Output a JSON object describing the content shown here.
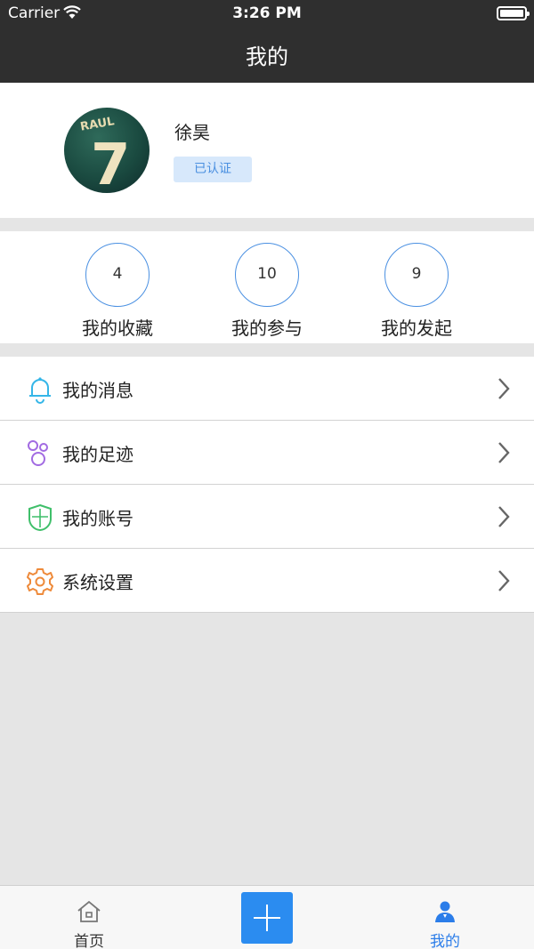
{
  "status_bar": {
    "carrier": "Carrier",
    "time": "3:26 PM"
  },
  "nav": {
    "title": "我的"
  },
  "profile": {
    "name": "徐昊",
    "badge": "已认证",
    "avatar_text": "RAUL",
    "avatar_number": "7"
  },
  "stats": [
    {
      "count": "4",
      "label": "我的收藏"
    },
    {
      "count": "10",
      "label": "我的参与"
    },
    {
      "count": "9",
      "label": "我的发起"
    }
  ],
  "menu": [
    {
      "label": "我的消息",
      "icon": "bell-icon",
      "color": "#35b6e8"
    },
    {
      "label": "我的足迹",
      "icon": "footprint-icon",
      "color": "#a26be2"
    },
    {
      "label": "我的账号",
      "icon": "shield-icon",
      "color": "#3fbf6a"
    },
    {
      "label": "系统设置",
      "icon": "gear-icon",
      "color": "#ee8a3a"
    }
  ],
  "tabbar": {
    "home": "首页",
    "mine": "我的",
    "active_color": "#2b7de9"
  }
}
